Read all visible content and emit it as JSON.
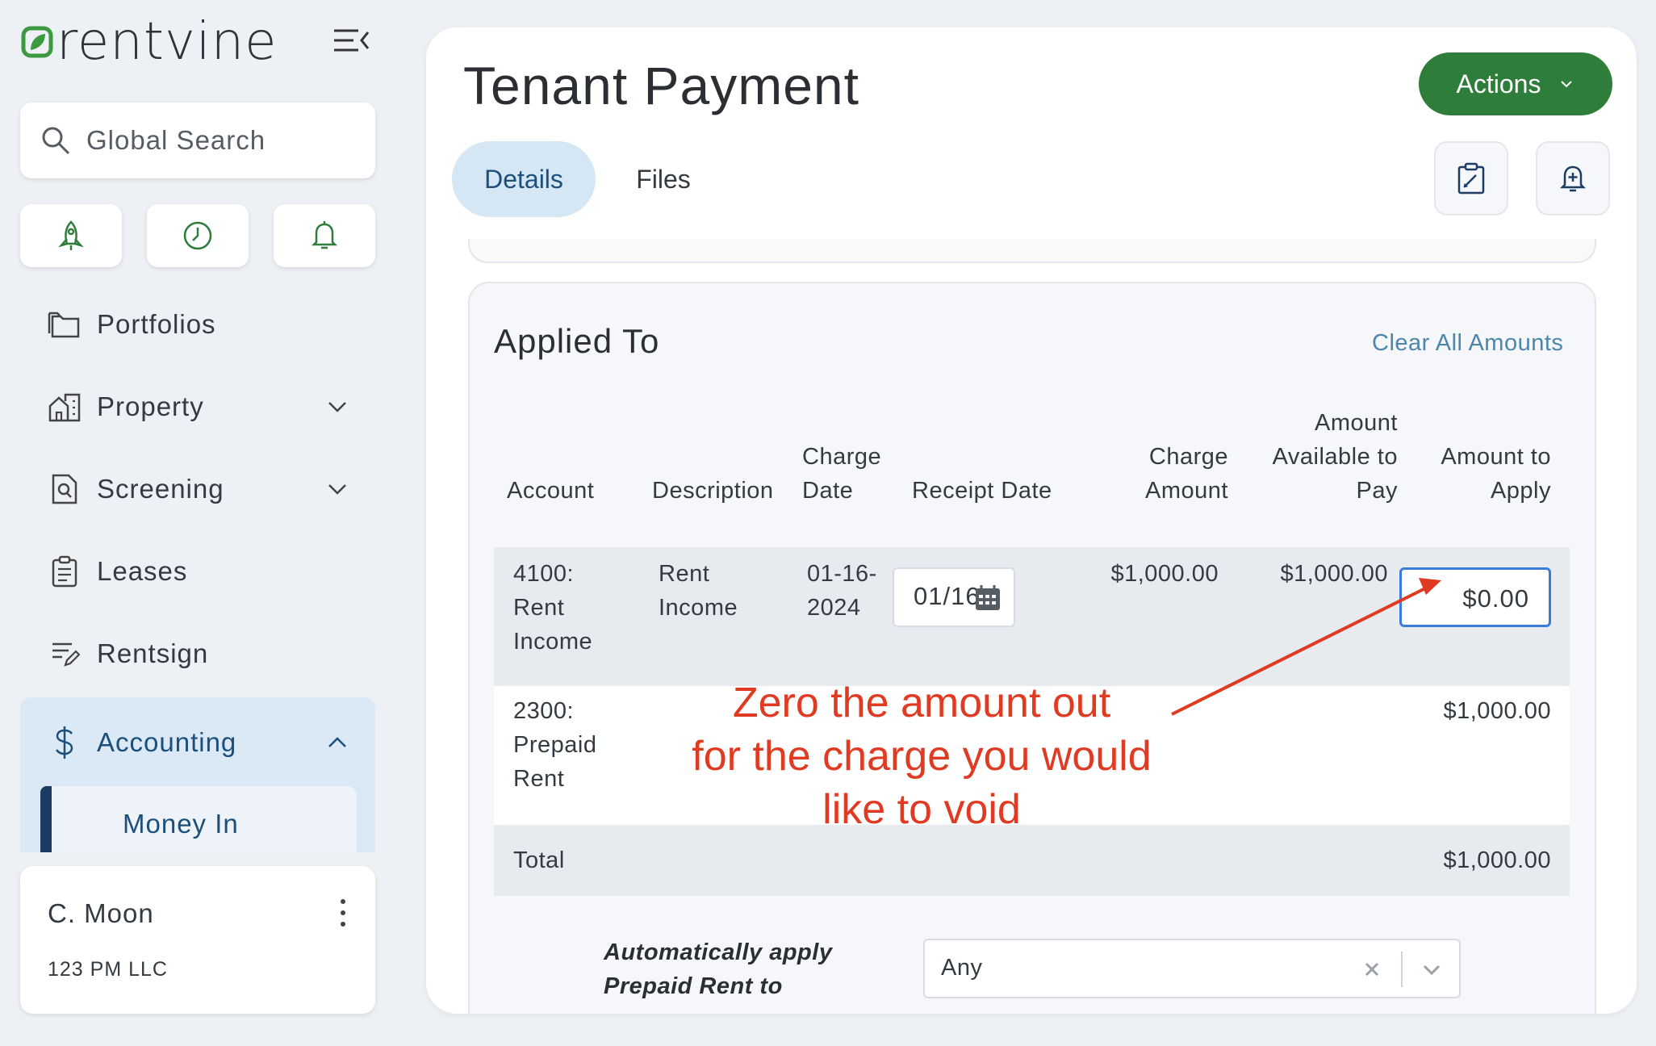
{
  "brand": {
    "logo_text": "rentvine",
    "accent": "#2f7d3a"
  },
  "sidebar": {
    "search_placeholder": "Global Search",
    "quick_actions": [
      {
        "icon": "rocket-icon"
      },
      {
        "icon": "clock-icon"
      },
      {
        "icon": "bell-icon"
      }
    ],
    "items": [
      {
        "label": "Portfolios",
        "icon": "folders-icon"
      },
      {
        "label": "Property",
        "icon": "buildings-icon"
      },
      {
        "label": "Screening",
        "icon": "screening-icon"
      },
      {
        "label": "Leases",
        "icon": "clipboard-icon"
      },
      {
        "label": "Rentsign",
        "icon": "sign-icon"
      },
      {
        "label": "Accounting",
        "icon": "dollar-icon"
      }
    ],
    "accounting_sub": {
      "label": "Money In"
    },
    "user": {
      "name": "C. Moon",
      "org": "123 PM LLC"
    }
  },
  "header": {
    "title": "Tenant Payment",
    "actions_label": "Actions",
    "tabs": [
      {
        "label": "Details"
      },
      {
        "label": "Files"
      }
    ]
  },
  "applied_to": {
    "title": "Applied To",
    "clear_label": "Clear All Amounts",
    "columns": {
      "account": "Account",
      "description": "Description",
      "charge_date_1": "Charge",
      "charge_date_2": "Date",
      "receipt_date": "Receipt Date",
      "charge_amount_1": "Charge",
      "charge_amount_2": "Amount",
      "available_1": "Amount",
      "available_2": "Available to",
      "available_3": "Pay",
      "apply_1": "Amount to",
      "apply_2": "Apply"
    },
    "rows": [
      {
        "account": [
          "4100:",
          "Rent",
          "Income"
        ],
        "description": [
          "Rent",
          "Income"
        ],
        "charge_date": [
          "01-16-",
          "2024"
        ],
        "receipt_date": "01/16",
        "charge_amount": "$1,000.00",
        "available": "$1,000.00",
        "apply": "$0.00"
      },
      {
        "account": [
          "2300:",
          "Prepaid",
          "Rent"
        ],
        "apply": "$1,000.00"
      }
    ],
    "total_label": "Total",
    "total_value": "$1,000.00",
    "auto_apply_label_1": "Automatically apply",
    "auto_apply_label_2": "Prepaid Rent to",
    "auto_apply_value": "Any"
  },
  "annotation": {
    "line1": "Zero the amount out",
    "line2": "for the charge you would",
    "line3": "like to void",
    "color": "#e03a22"
  }
}
